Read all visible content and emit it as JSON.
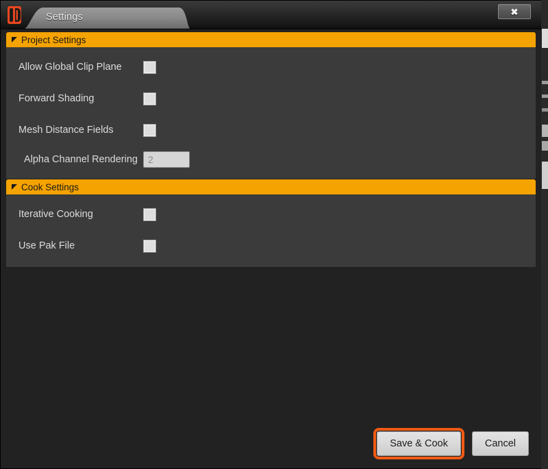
{
  "window": {
    "logo_icon": "unreal-engine-logo-icon",
    "close_label": "✖"
  },
  "tabs": [
    {
      "label": "Settings",
      "active": true
    }
  ],
  "groups": [
    {
      "title": "Project Settings",
      "collapse_icon": "triangle-expanded-icon",
      "rows": [
        {
          "label": "Allow Global Clip Plane",
          "control": "checkbox",
          "checked": false
        },
        {
          "label": "Forward Shading",
          "control": "checkbox",
          "checked": false
        },
        {
          "label": "Mesh Distance Fields",
          "control": "checkbox",
          "checked": false
        },
        {
          "label": "Alpha Channel Rendering",
          "control": "text",
          "value": "2"
        }
      ]
    },
    {
      "title": "Cook Settings",
      "collapse_icon": "triangle-expanded-icon",
      "rows": [
        {
          "label": "Iterative Cooking",
          "control": "checkbox",
          "checked": false
        },
        {
          "label": "Use Pak File",
          "control": "checkbox",
          "checked": false
        }
      ]
    }
  ],
  "footer": {
    "save_label": "Save & Cook",
    "cancel_label": "Cancel"
  },
  "colors": {
    "accent_orange": "#F5A300",
    "focus_orange": "#F05A14",
    "panel_bg": "#3B3B3B",
    "window_bg": "#222222",
    "label_text": "#DCDCDC"
  }
}
